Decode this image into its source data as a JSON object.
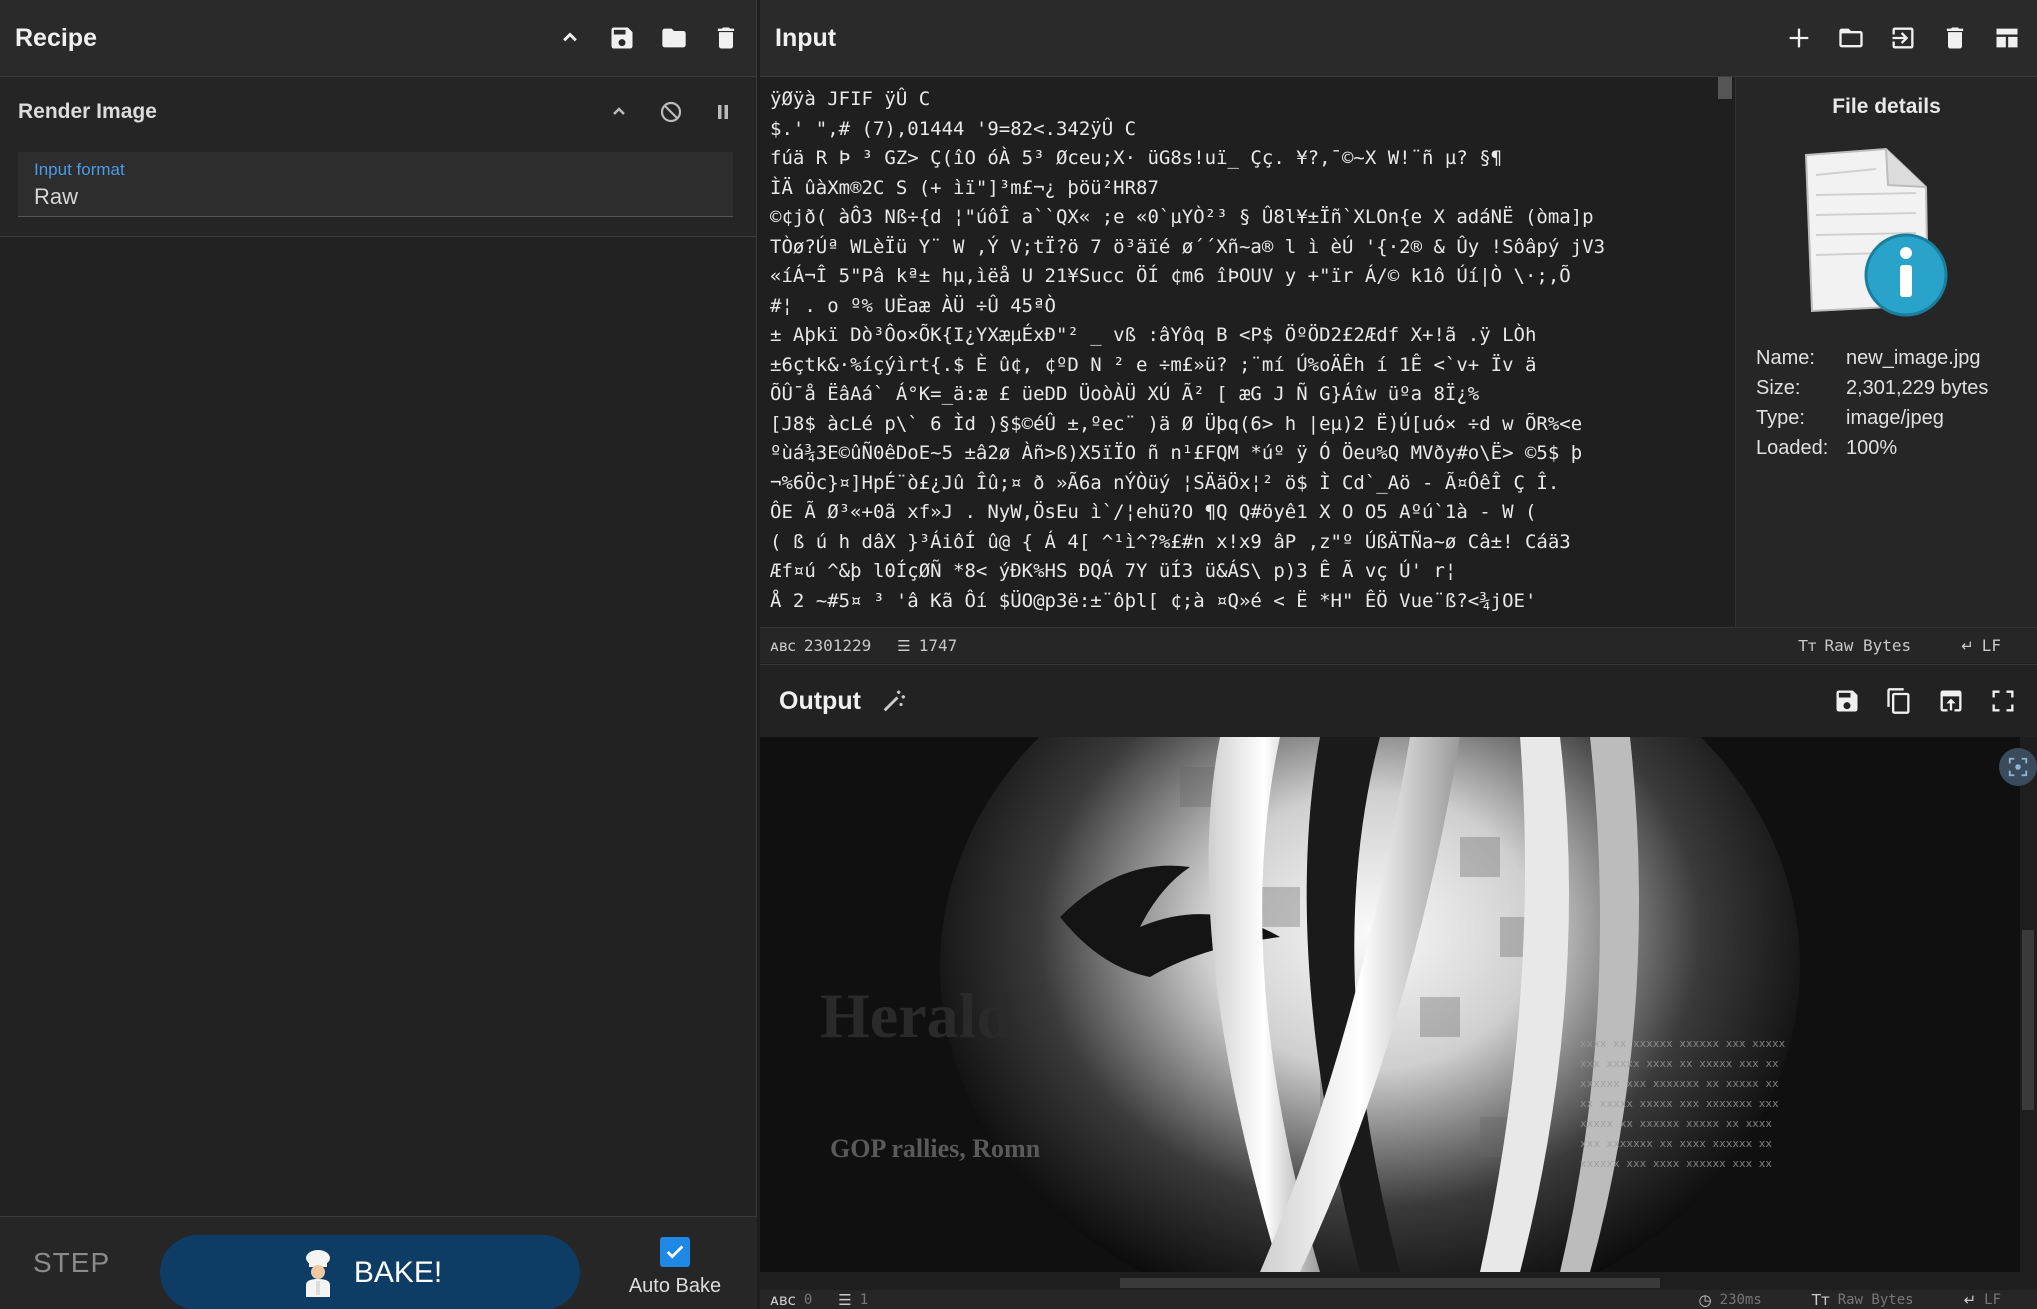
{
  "recipe": {
    "title": "Recipe",
    "operation": {
      "name": "Render Image",
      "field_label": "Input format",
      "field_value": "Raw"
    },
    "step_label": "STEP",
    "bake_label": "BAKE!",
    "autobake_label": "Auto Bake",
    "autobake_checked": true
  },
  "input": {
    "title": "Input",
    "lines": [
      "ÿØÿà JFIF  ÿÛ C",
      " $.' \",#  (7),01444 '9=82<.342ÿÛ C",
      "fúä R Þ ³ GZ> Ç(îO óÀ 5³ Øceu;X· üG8s!uï_ Çç. ¥?,¯©~X W!¨ñ µ? §¶",
      "ÌÄ ûàXm®2C S (+ ìï\"]³m£¬¿ þöü²HR87",
      "©¢jð( àÔ3 Nß÷{d ¦\"úôÎ a``QX« ;e «0`µYÒ²³ § Û8l¥±Ïñ`XLOn{e X adáNË (òma]p",
      "TÒø?Úª WLèÏü Y¨ W ,Ý V;tÏ?ö 7 ö³äïé ø´´Xñ~a®  l ì èÚ '{·2® & Ûy !Sôâpý jV3",
      "«íÁ¬Î 5\"Pâ kª± hµ,ìëå U 21¥Succ ÖÍ ¢m6 îÞOUV y +\"ïr Á/© k1ô Úí|Ò \\·;,Õ",
      "#¦ . o º% UÈaæ ÀÜ ÷Û 45ªÒ",
      "± Aþkï Dò³Ôo×ÕK{I¿YXæµÉxÐ\"² _ vß :âYôq B <P$ ÖºÖD2£2Ædf X+!ã .ÿ LÒh",
      "±6çtk&·%íçýìrt{.$ È û¢, ¢ºD N ² e ÷m£»ü? ;¨mí Ú%oÄÊh í 1Ê <`v+ Ïv ä",
      "ÕÛ¯å ËâAá` Á°K=_ä:æ £ üeDD ÜoòÀÜ XÚ Ã² [ æG J Ñ G}Áîw üºa 8Ï¿%",
      "[J8$ àcLé p\\` 6 Ìd )§$©éÛ ±,ºec¨ )ä Ø Üþq(6> h |eµ)2 Ë)Ú[uó× ÷d w ÕR%<e",
      "ºùá¾3E©ûÑ0êDoE~5 ±â2ø Àñ>ß)X5ïÏO ñ n¹£FQM *úº ÿ Ó Öeu%Q MVðy#o\\Ë> ©5$ þ",
      "¬%6Öc}¤]HpÉ¨ò£¿Jû Îû;¤ ð »Ã6a nÝÒüý ¦SÄäÖx¦² ö$ Ì Cd`_Aö - Ã¤ÔêÎ Ç Î.",
      "ÔE Ã Ø³«+0ã xf»J . NyW,ÖsEu ì`/¦ehü?O ¶Q Q#öyê1 X O O5 Aºú`1à - W (",
      "( ß ú h dâX }³ÁiôÍ û@ { Á 4[ ^¹ì^?%£#n x!x9 âP ,z\"º ÚßÄTÑa~ø Câ±! Cáä3",
      "Æf¤ú ^&þ l0ÍçØÑ *8< ýÐK%HS ÐQÁ 7Y üÍ3 ü&ÁS\\ p)3 Ê Ã vç Ú' r¦",
      "Å 2 ~#5¤ ³ 'â Kã Ôí $ÜO@p3ë:±¨ôþl[ ¢;à ¤Q»é < Ë *H\" ÊÖ Vue¨ß?<¾jOE'"
    ],
    "status": {
      "length": "2301229",
      "lines": "1747",
      "encoding": "Raw Bytes",
      "eol": "LF"
    }
  },
  "file_details": {
    "title": "File details",
    "name_key": "Name:",
    "name": "new_image.jpg",
    "size_key": "Size:",
    "size": "2,301,229 bytes",
    "type_key": "Type:",
    "type": "image/jpeg",
    "loaded_key": "Loaded:",
    "loaded": "100%"
  },
  "output": {
    "title": "Output",
    "status": {
      "length": "0",
      "lines": "1",
      "time": "230ms",
      "encoding": "Raw Bytes",
      "eol": "LF"
    },
    "image_text": [
      "GOP rallies, Romn",
      "Herald"
    ]
  },
  "colors": {
    "accent": "#1e88e5",
    "bake": "#0d3d64",
    "control_char": "#e01b1b"
  }
}
